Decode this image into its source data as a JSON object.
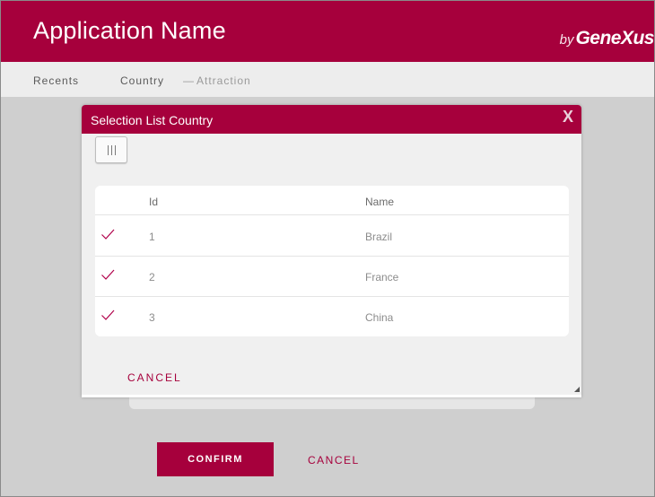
{
  "header": {
    "title": "Application Name",
    "brand_prefix": "by",
    "brand_name": "GeneXus"
  },
  "breadcrumb": {
    "recents": "Recents",
    "current": "Country",
    "separator": "—",
    "subitem": "Attraction"
  },
  "modal": {
    "title": "Selection List Country",
    "close_label": "X",
    "column_toggle_icon": "columns-icon",
    "grid": {
      "columns": [
        "Id",
        "Name"
      ],
      "rows": [
        {
          "id": "1",
          "name": "Brazil"
        },
        {
          "id": "2",
          "name": "France"
        },
        {
          "id": "3",
          "name": "China"
        }
      ],
      "row_icon": "checkmark-icon"
    },
    "cancel_label": "CANCEL"
  },
  "page": {
    "confirm_label": "CONFIRM",
    "cancel_label": "CANCEL"
  },
  "colors": {
    "accent": "#a6003c",
    "overlay": "#cfcfcf",
    "bar": "#ededed"
  }
}
